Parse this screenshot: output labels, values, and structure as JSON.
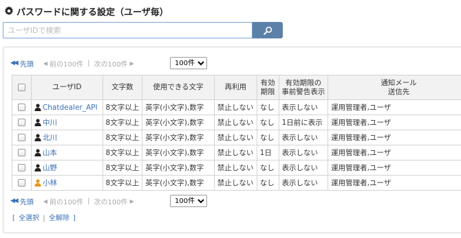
{
  "header": {
    "title": "パスワードに関する設定（ユーザ毎）",
    "icon": "gear-icon"
  },
  "search": {
    "placeholder": "ユーザIDで検索",
    "value": "",
    "button_icon": "search-icon"
  },
  "pager": {
    "first": "先頭",
    "prev": "前の100件",
    "sep": "|",
    "next": "次の100件",
    "per_page": "100件"
  },
  "table": {
    "headers": {
      "user_id": "ユーザID",
      "length": "文字数",
      "chars": "使用できる文字",
      "reuse": "再利用",
      "expiry_1": "有効",
      "expiry_2": "期限",
      "warning_1": "有効期限の",
      "warning_2": "事前警告表示",
      "notify_1": "通知メール",
      "notify_2": "送信先"
    },
    "rows": [
      {
        "user_id": "Chatdealer_API",
        "length": "8文字以上",
        "chars": "英字(小文字),数字",
        "reuse": "禁止しない",
        "expiry": "なし",
        "warning": "表示しない",
        "notify": "運用管理者,ユーザ",
        "icon_color": "#222222"
      },
      {
        "user_id": "中川",
        "length": "8文字以上",
        "chars": "英字(小文字),数字",
        "reuse": "禁止しない",
        "expiry": "なし",
        "warning": "1日前に表示",
        "notify": "運用管理者,ユーザ",
        "icon_color": "#222222"
      },
      {
        "user_id": "北川",
        "length": "8文字以上",
        "chars": "英字(小文字),数字",
        "reuse": "禁止しない",
        "expiry": "なし",
        "warning": "表示しない",
        "notify": "運用管理者,ユーザ",
        "icon_color": "#222222"
      },
      {
        "user_id": "山本",
        "length": "8文字以上",
        "chars": "英字(小文字),数字",
        "reuse": "禁止しない",
        "expiry": "1日",
        "warning": "表示しない",
        "notify": "運用管理者,ユーザ",
        "icon_color": "#222222"
      },
      {
        "user_id": "山野",
        "length": "8文字以上",
        "chars": "英字(小文字),数字",
        "reuse": "禁止しない",
        "expiry": "なし",
        "warning": "表示しない",
        "notify": "運用管理者,ユーザ",
        "icon_color": "#222222"
      },
      {
        "user_id": "小林",
        "length": "8文字以上",
        "chars": "英字(小文字),数字",
        "reuse": "禁止しない",
        "expiry": "なし",
        "warning": "表示しない",
        "notify": "運用管理者,ユーザ",
        "icon_color": "#e6961e"
      }
    ]
  },
  "selection": {
    "open": "[",
    "select_all": "全選択",
    "pipe": "|",
    "deselect_all": "全解除",
    "close": "]"
  },
  "colors": {
    "link": "#3a6fb5",
    "search_button": "#5b81a9",
    "header_bg": "#f2f2f2"
  }
}
